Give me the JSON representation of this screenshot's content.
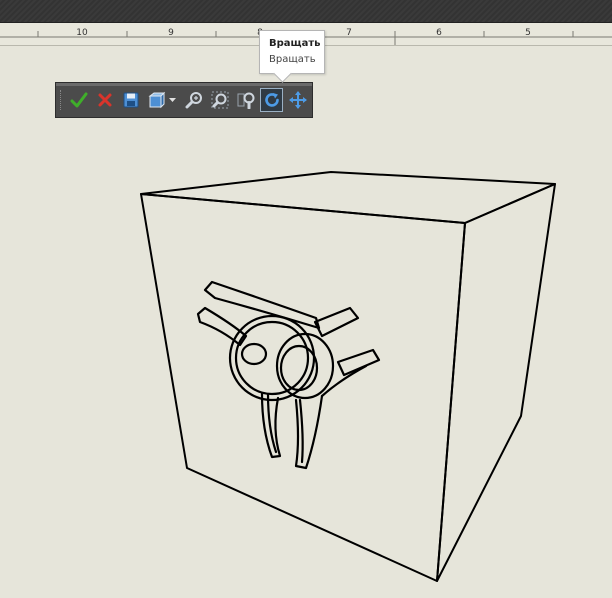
{
  "ruler": {
    "labels": [
      {
        "text": "10"
      },
      {
        "text": "9"
      },
      {
        "text": "8"
      },
      {
        "text": "7"
      },
      {
        "text": "6"
      },
      {
        "text": "5"
      }
    ]
  },
  "toolbar": {
    "buttons": [
      {
        "icon": "checkmark-icon",
        "color": "#3fae2a"
      },
      {
        "icon": "cancel-icon",
        "color": "#d9342b"
      },
      {
        "icon": "save-icon",
        "color": "#4d8fd4"
      },
      {
        "icon": "view-orientation-icon",
        "color": "#4d8fd4"
      },
      {
        "icon": "zoom-icon",
        "color": "#cfd6de"
      },
      {
        "icon": "zoom-fit-icon",
        "color": "#cfd6de"
      },
      {
        "icon": "zoom-region-icon",
        "color": "#cfd6de"
      },
      {
        "icon": "rotate-icon",
        "color": "#4d9be6",
        "active": true
      },
      {
        "icon": "pan-icon",
        "color": "#4d9be6"
      }
    ]
  },
  "tooltip": {
    "title": "Вращать",
    "description": "Вращать"
  }
}
